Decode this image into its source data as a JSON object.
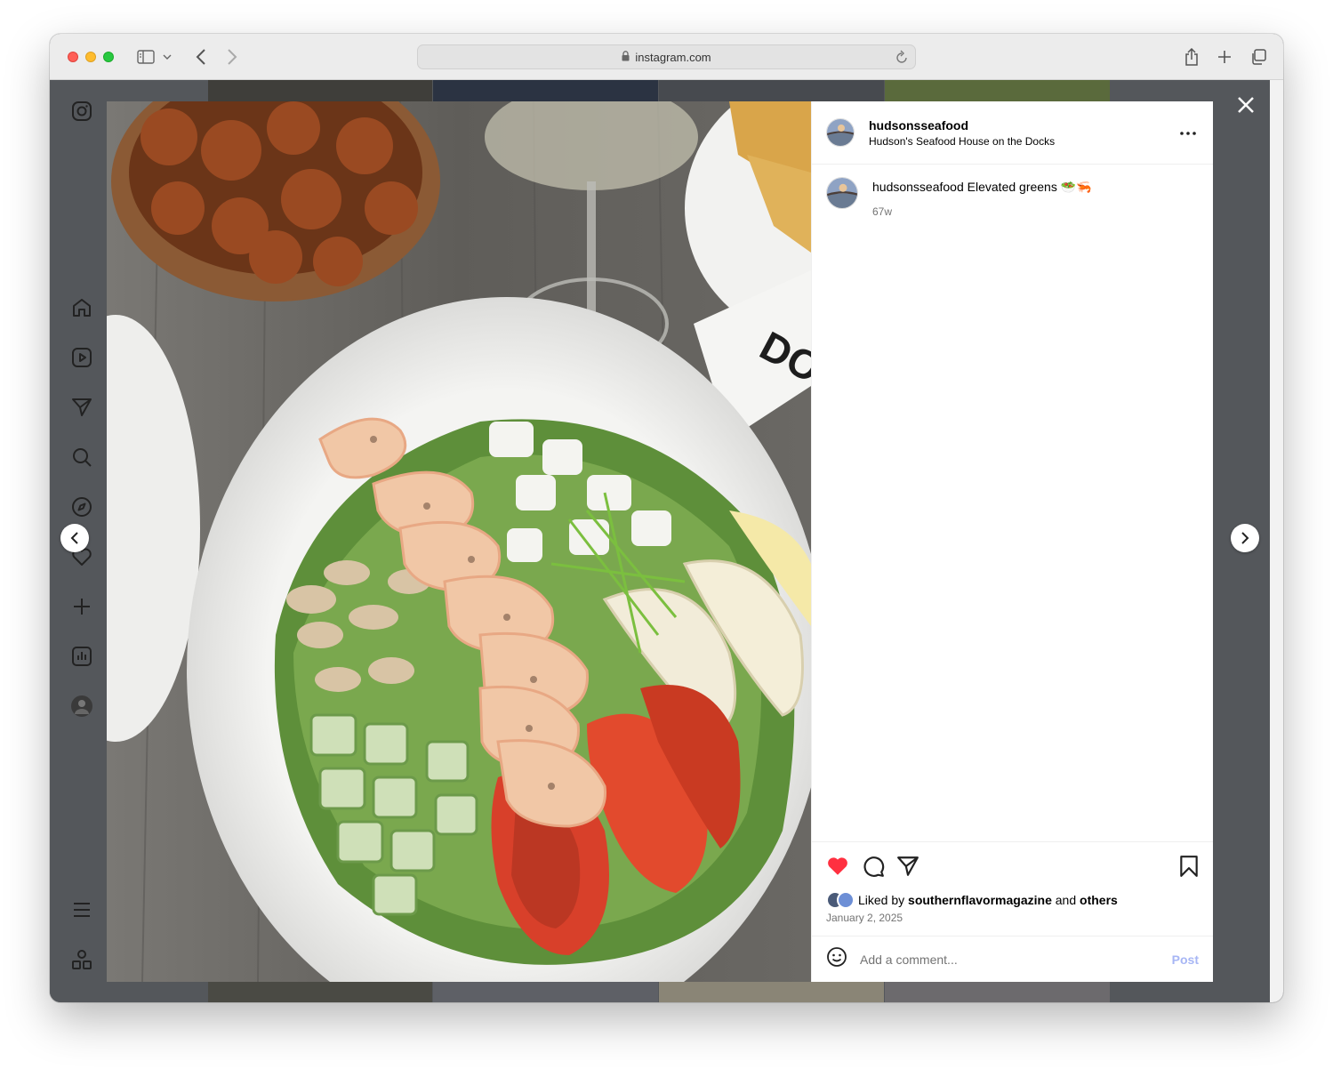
{
  "browser": {
    "url": "instagram.com"
  },
  "post": {
    "username": "hudsonsseafood",
    "location": "Hudson's Seafood House on the Docks",
    "caption_user": "hudsonsseafood",
    "caption_text": "Elevated greens 🥗🦐",
    "time_ago": "67w",
    "liked_prefix": "Liked by",
    "liked_user": "southernflavormagazine",
    "liked_and": "and",
    "liked_others": "others",
    "date": "January 2, 2025",
    "comment_placeholder": "Add a comment...",
    "post_label": "Post",
    "liked": true
  },
  "colors": {
    "like_red": "#ff3040",
    "post_button": "#a7b6f5",
    "overlay": "#54575b"
  },
  "icons": {
    "nav": [
      "instagram-icon",
      "home-icon",
      "reels-icon",
      "messages-icon",
      "search-icon",
      "explore-icon",
      "notifications-icon",
      "create-icon",
      "dashboard-icon",
      "profile-icon",
      "menu-icon",
      "more-apps-icon"
    ]
  }
}
